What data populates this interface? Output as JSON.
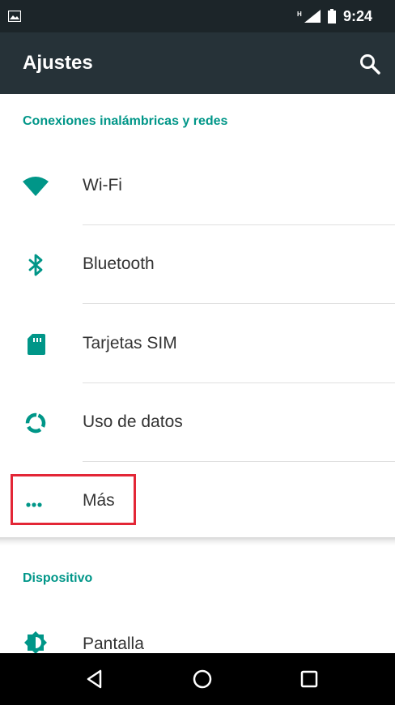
{
  "status_bar": {
    "time": "9:24",
    "network": "H"
  },
  "app_bar": {
    "title": "Ajustes"
  },
  "sections": {
    "wireless": {
      "header": "Conexiones inalámbricas y redes"
    },
    "device": {
      "header": "Dispositivo"
    }
  },
  "items": {
    "wifi": "Wi-Fi",
    "bluetooth": "Bluetooth",
    "sim": "Tarjetas SIM",
    "data_usage": "Uso de datos",
    "more": "Más",
    "display": "Pantalla"
  },
  "colors": {
    "accent": "#009688",
    "app_bar": "#263238",
    "status_bar": "#1c2529",
    "highlight": "#e32636"
  }
}
